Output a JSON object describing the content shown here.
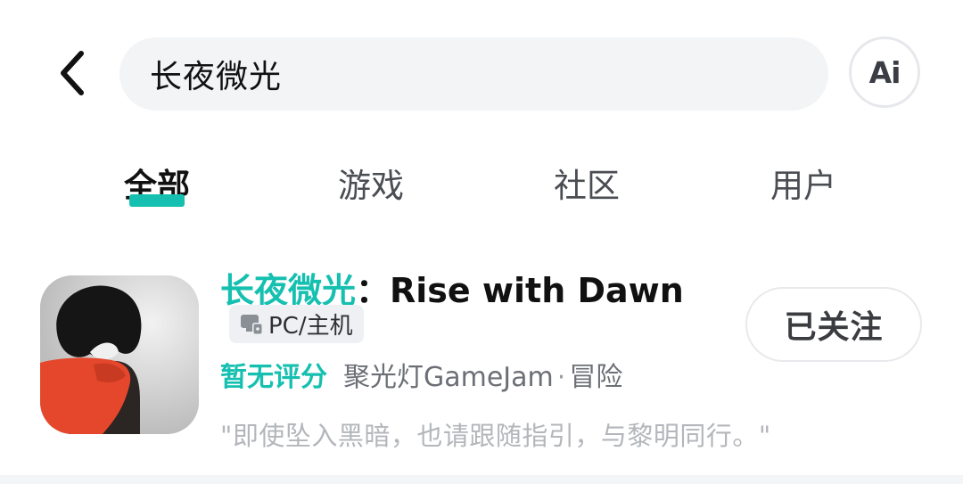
{
  "search": {
    "query": "长夜微光"
  },
  "ai_button": {
    "label": "Ai"
  },
  "tabs": [
    {
      "label": "全部",
      "active": true
    },
    {
      "label": "游戏",
      "active": false
    },
    {
      "label": "社区",
      "active": false
    },
    {
      "label": "用户",
      "active": false
    }
  ],
  "result": {
    "title_highlight": "长夜微光",
    "title_rest": "：Rise with Dawn",
    "platform": "PC/主机",
    "rating": "暂无评分",
    "tag_source": "聚光灯GameJam",
    "separator": "·",
    "genre": "冒险",
    "quote": "\"即使坠入黑暗，也请跟随指引，与黎明同行。\"",
    "follow_label": "已关注"
  },
  "colors": {
    "accent": "#16c0b0",
    "search_bg": "#f3f4f6",
    "muted_text": "#b3b6ba"
  },
  "icons": {
    "back": "chevron-left-icon",
    "platform": "console-icon"
  }
}
